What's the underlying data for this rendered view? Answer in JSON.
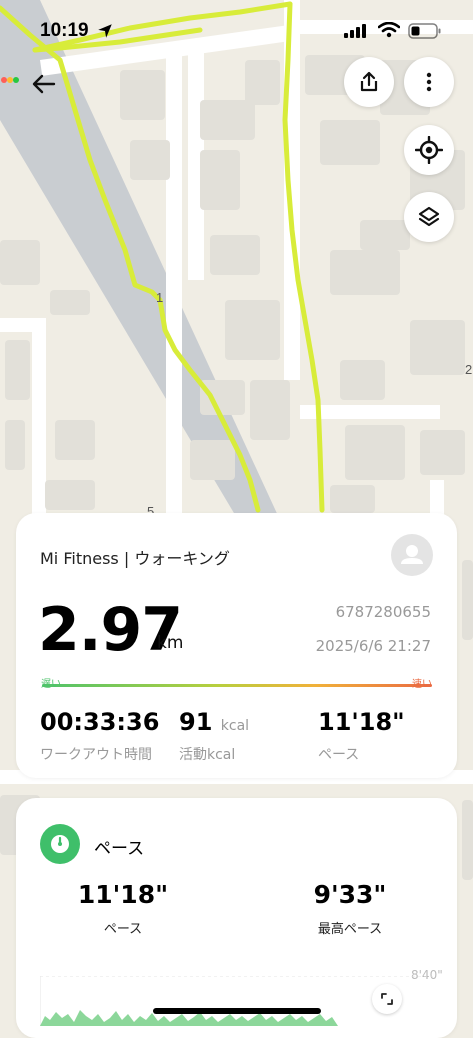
{
  "status_bar": {
    "time": "10:19"
  },
  "map": {
    "marker_1": "1",
    "marker_2": "2",
    "marker_5": "5"
  },
  "summary": {
    "source": "Mi Fitness | ウォーキング",
    "distance": "2.97",
    "distance_unit": "km",
    "workout_id": "6787280655",
    "date": "2025/6/6 21:27",
    "slow_label": "遅い",
    "fast_label": "速い",
    "duration": "00:33:36",
    "duration_label": "ワークアウト時間",
    "kcal_value": "91",
    "kcal_unit": "kcal",
    "kcal_label": "活動kcal",
    "pace": "11'18\"",
    "pace_label": "ペース"
  },
  "pace_card": {
    "title": "ペース",
    "avg_value": "11'18\"",
    "avg_label": "ペース",
    "best_value": "9'33\"",
    "best_label": "最高ペース",
    "axis_label": "8'40\""
  },
  "icons": [
    "back-arrow-icon",
    "share-icon",
    "more-icon",
    "locate-icon",
    "layers-icon",
    "avatar-icon",
    "gauge-icon",
    "expand-icon"
  ],
  "colors": {
    "route": "#d8ec3a",
    "accent_green": "#3fbf6a",
    "bar_slow": "#4ec36b",
    "bar_fast": "#ea6a42"
  }
}
